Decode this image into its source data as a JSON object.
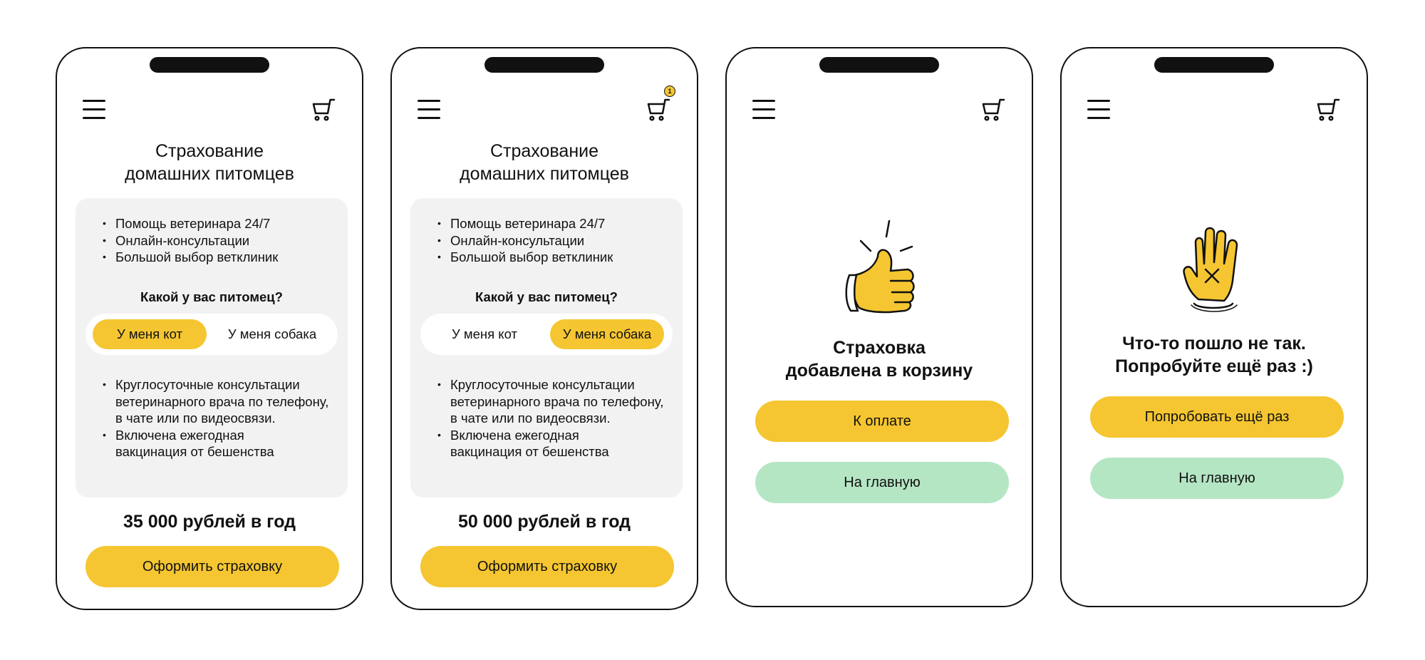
{
  "screen1": {
    "title_line1": "Страхование",
    "title_line2": "домашних питомцев",
    "features": [
      "Помощь ветеринара 24/7",
      "Онлайн-консультации",
      "Большой выбор ветклиник"
    ],
    "question": "Какой у вас питомец?",
    "option_cat": "У меня кот",
    "option_dog": "У меня собака",
    "selected": "cat",
    "details": [
      "Круглосуточные консультации ветеринарного врача по телефону, в чате или по видеосвязи.",
      "Включена ежегодная вакцинация от бешенства"
    ],
    "price": "35 000 рублей в год",
    "cta": "Оформить страховку"
  },
  "screen2": {
    "title_line1": "Страхование",
    "title_line2": "домашних питомцев",
    "cart_count": "1",
    "features": [
      "Помощь ветеринара 24/7",
      "Онлайн-консультации",
      "Большой выбор ветклиник"
    ],
    "question": "Какой у вас питомец?",
    "option_cat": "У меня кот",
    "option_dog": "У меня собака",
    "selected": "dog",
    "details": [
      "Круглосуточные консультации ветеринарного врача по телефону, в чате или по видеосвязи.",
      "Включена ежегодная вакцинация от бешенства"
    ],
    "price": "50 000 рублей в год",
    "cta": "Оформить страховку"
  },
  "screen3": {
    "illustration": "thumbs-up-icon",
    "message_line1": "Страховка",
    "message_line2": "добавлена в корзину",
    "primary_button": "К оплате",
    "secondary_button": "На главную"
  },
  "screen4": {
    "illustration": "stop-hand-icon",
    "message_line1": "Что-то пошло не так.",
    "message_line2": "Попробуйте ещё раз :)",
    "primary_button": "Попробовать ещё раз",
    "secondary_button": "На главную"
  },
  "colors": {
    "accent_yellow": "#f5c631",
    "secondary_green": "#b5e6c4",
    "card_gray": "#f2f2f2",
    "ink": "#111111"
  }
}
